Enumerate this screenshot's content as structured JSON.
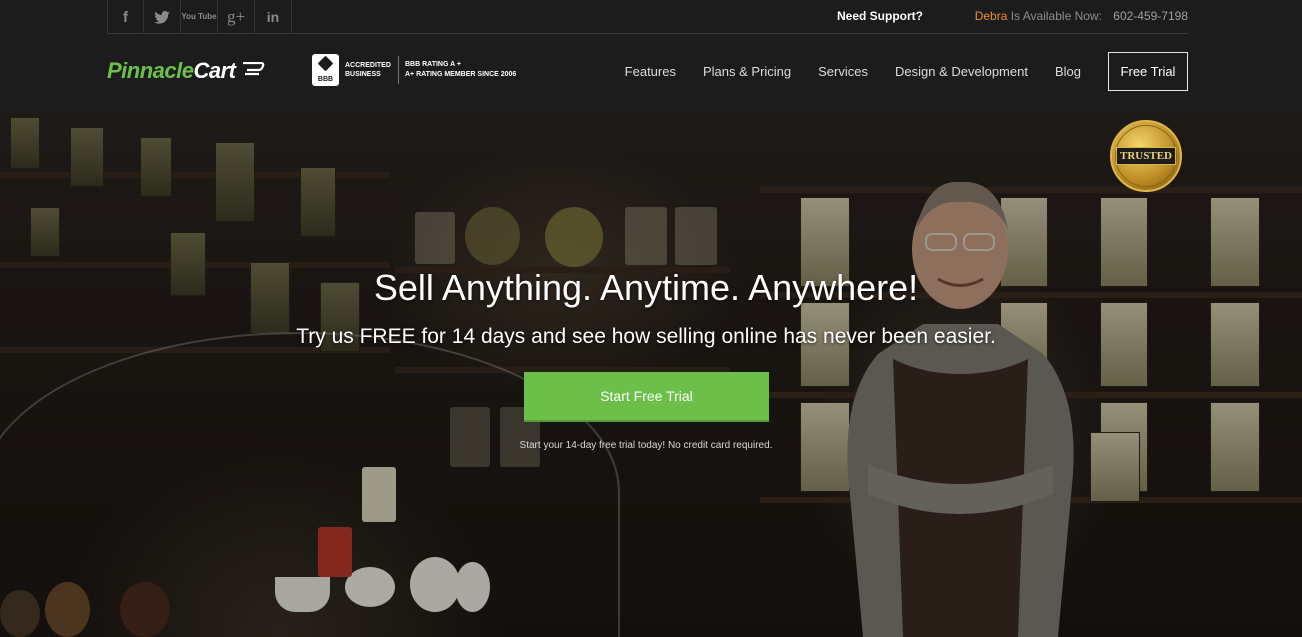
{
  "topbar": {
    "social_icons": [
      "facebook-icon",
      "twitter-icon",
      "youtube-icon",
      "google-plus-icon",
      "linkedin-icon"
    ],
    "social_glyphs": [
      "f",
      "",
      "You Tube",
      "g+",
      "in"
    ],
    "need_support": "Need Support?",
    "agent_name": "Debra",
    "available_text": "Is Available Now:",
    "phone": "602-459-7198"
  },
  "header": {
    "logo_part1": "Pinnacle",
    "logo_part2": "Cart",
    "bbb_seal": "BBB",
    "bbb_accredited_line1": "ACCREDITED",
    "bbb_accredited_line2": "BUSINESS",
    "bbb_rating_line1": "BBB RATING A +",
    "bbb_rating_line2": "A+ RATING MEMBER SINCE 2006"
  },
  "nav": {
    "items": [
      "Features",
      "Plans & Pricing",
      "Services",
      "Design & Development",
      "Blog"
    ],
    "cta": "Free Trial"
  },
  "hero": {
    "headline": "Sell Anything. Anytime. Anywhere!",
    "subheadline": "Try us FREE for 14 days and see how selling online has never been easier.",
    "button": "Start Free Trial",
    "note": "Start your 14-day free trial today! No credit card required.",
    "badge": "TRUSTED"
  },
  "colors": {
    "brand_green": "#6cc04a",
    "header_bg": "#1c1c1c",
    "agent_orange": "#f08c2a"
  }
}
